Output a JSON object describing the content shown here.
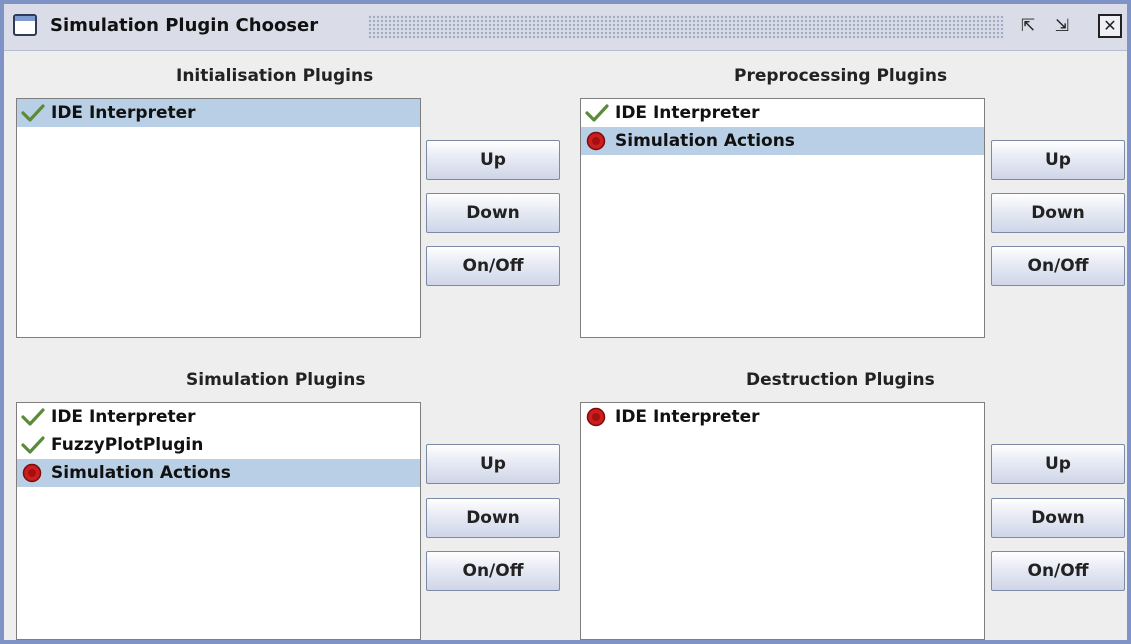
{
  "window": {
    "title": "Simulation Plugin Chooser",
    "minimize_glyph": "⇱",
    "maximize_glyph": "⇲",
    "close_glyph": "☒"
  },
  "panels": {
    "initialisation": {
      "title": "Initialisation Plugins",
      "items": [
        {
          "label": "IDE Interpreter",
          "status": "on",
          "selected": true
        }
      ]
    },
    "preprocessing": {
      "title": "Preprocessing Plugins",
      "items": [
        {
          "label": "IDE Interpreter",
          "status": "on",
          "selected": false
        },
        {
          "label": "Simulation Actions",
          "status": "off",
          "selected": true
        }
      ]
    },
    "simulation": {
      "title": "Simulation Plugins",
      "items": [
        {
          "label": "IDE Interpreter",
          "status": "on",
          "selected": false
        },
        {
          "label": "FuzzyPlotPlugin",
          "status": "on",
          "selected": false
        },
        {
          "label": "Simulation Actions",
          "status": "off",
          "selected": true
        }
      ]
    },
    "destruction": {
      "title": "Destruction Plugins",
      "items": [
        {
          "label": "IDE Interpreter",
          "status": "off",
          "selected": false
        }
      ]
    }
  },
  "buttons": {
    "up": "Up",
    "down": "Down",
    "onoff": "On/Off"
  },
  "icons": {
    "on": "checkmark-icon",
    "off": "stop-icon"
  },
  "colors": {
    "selection": "#b8cfe5",
    "check": "#5a8a3a",
    "stop": "#cc1e1e",
    "window_border": "#7f93c6"
  }
}
